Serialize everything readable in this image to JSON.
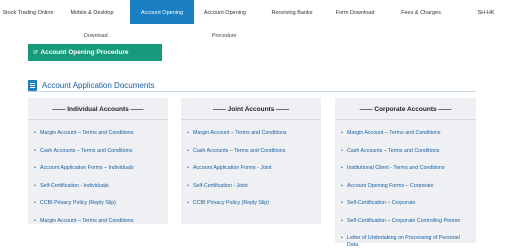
{
  "nav": {
    "items": [
      {
        "label": "Stock Trading Online",
        "active": false
      },
      {
        "label": "Mobile & Desktop",
        "active": false
      },
      {
        "label": "Account Opening",
        "active": true
      },
      {
        "label": "Account Opening",
        "active": false
      },
      {
        "label": "Receiving Banks",
        "active": false
      },
      {
        "label": "Form Download",
        "active": false
      },
      {
        "label": "Fees & Charges",
        "active": false
      },
      {
        "label": "SH-HK",
        "active": false
      }
    ],
    "sub_labels": [
      "Download",
      "Procedure"
    ]
  },
  "procedure_button": {
    "icon": "hand-pointer-icon",
    "label": "Account Opening Procedure"
  },
  "section": {
    "icon": "document-icon",
    "title": "Account Application Documents"
  },
  "panels": [
    {
      "title": "—— Individual Accounts ——",
      "items": [
        "Margin Account – Terms and Conditions",
        "Cash Accounts – Terms and Conditions",
        "Account Application Forms – Individuals",
        "Self-Certification - Individuals",
        "CCBI Privacy Policy (Reply Slip)",
        "Margin Account – Terms and Conditions"
      ]
    },
    {
      "title": "—— Joint Accounts ——",
      "items": [
        "Margin Account – Terms and Conditions",
        "Cash Accounts – Terms and Conditions",
        "Account Application Forms - Joint",
        "Self-Certification - Joint",
        "CCBI Privacy Policy (Reply Slip)"
      ]
    },
    {
      "title": "—— Corporate Accounts ——",
      "items": [
        "Margin Account – Terms and Conditions",
        "Cash Accounts – Terms and Conditions",
        "Institutional Client - Terms and Conditions",
        "Account Opening Forms – Corporate",
        "Self-Certification – Corporate",
        "Self-Certification – Corporate Controlling Person",
        "Letter of Undertaking on Processing of Personal Data"
      ]
    }
  ],
  "colors": {
    "accent": "#1b7fc4",
    "button": "#169a7b",
    "panel_bg": "#eef0f3",
    "link": "#1b5fa0"
  }
}
